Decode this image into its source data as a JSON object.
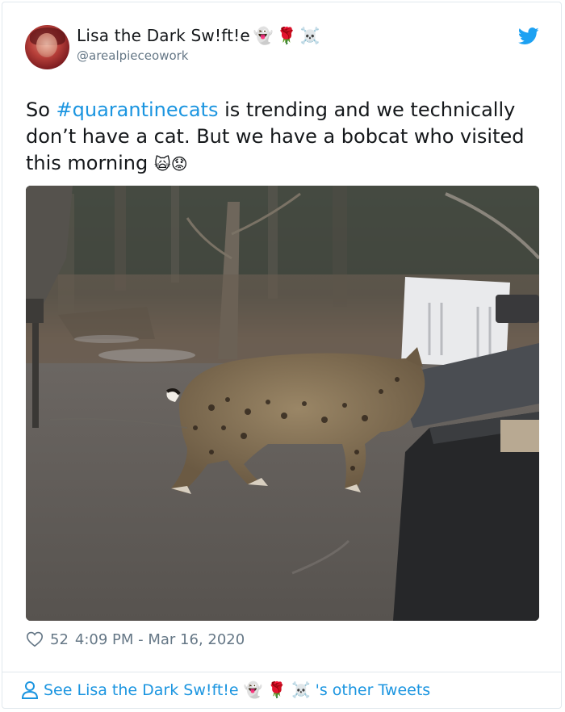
{
  "tweet": {
    "display_name": "Lisa the Dark Sw!ft!e",
    "name_emojis": [
      "👻",
      "🌹",
      "☠️"
    ],
    "handle": "@arealpieceowork",
    "text_prefix": "So ",
    "hashtag": "#quarantinecats",
    "text_line1_rest": " is trending and we technically",
    "text_line2": "don’t have a cat.  But we have a bobcat who visited",
    "text_line3": "this morning ",
    "text_emojis": [
      "🙀",
      "😟"
    ],
    "like_count": "52",
    "timestamp": "4:09 PM - Mar 16, 2020"
  },
  "footer": {
    "prefix": "See Lisa the Dark Sw!ft!e ",
    "emojis": [
      "👻",
      "🌹",
      "☠️"
    ],
    "suffix": "'s other Tweets"
  },
  "colors": {
    "link": "#1b95e0",
    "muted": "#657786",
    "text": "#14171a",
    "border": "#e1e8ed"
  },
  "icons": {
    "platform": "twitter-bird-icon",
    "like": "heart-icon",
    "profile": "person-icon"
  }
}
